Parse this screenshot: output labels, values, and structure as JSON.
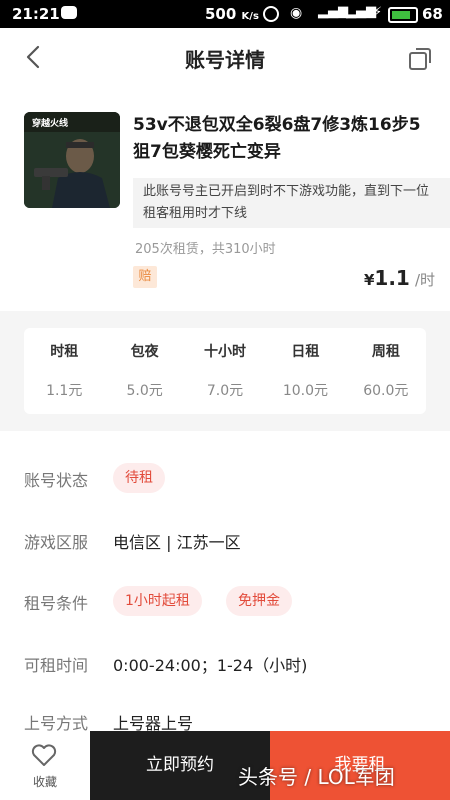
{
  "statusbar": {
    "time": "21:21",
    "speed": "500",
    "speed_unit": "K/s",
    "battery": "68"
  },
  "header": {
    "title": "账号详情"
  },
  "account": {
    "title": "53v不退包双全6裂6盘7修3炼16步5狙7包葵樱死亡变异",
    "notice": "此账号号主已开启到时不下游戏功能，直到下一位租客租用时才下线",
    "stats": "205次租赁，共310小时",
    "badge": "赔",
    "price_currency": "¥",
    "price_amount": "1.1",
    "price_unit": "/时",
    "thumb_logo": "穿越火线"
  },
  "rates": [
    {
      "label": "时租",
      "value": "1.1元"
    },
    {
      "label": "包夜",
      "value": "5.0元"
    },
    {
      "label": "十小时",
      "value": "7.0元"
    },
    {
      "label": "日租",
      "value": "10.0元"
    },
    {
      "label": "周租",
      "value": "60.0元"
    }
  ],
  "details": {
    "status_label": "账号状态",
    "status_value": "待租",
    "server_label": "游戏区服",
    "server_value": "电信区 | 江苏一区",
    "conditions_label": "租号条件",
    "conditions": [
      "1小时起租",
      "免押金"
    ],
    "time_label": "可租时间",
    "time_value": "0:00-24:00；1-24（小时)",
    "login_label": "上号方式",
    "login_value": "上号器上号"
  },
  "bottombar": {
    "fav_label": "收藏",
    "reserve_label": "立即预约",
    "rent_label": "我要租",
    "watermark": "头条号 / LOL军团"
  },
  "colors": {
    "accent": "#ee5234",
    "dark": "#1d1d1d",
    "pill_bg": "#fdecec",
    "pill_text": "#e24b3b"
  }
}
